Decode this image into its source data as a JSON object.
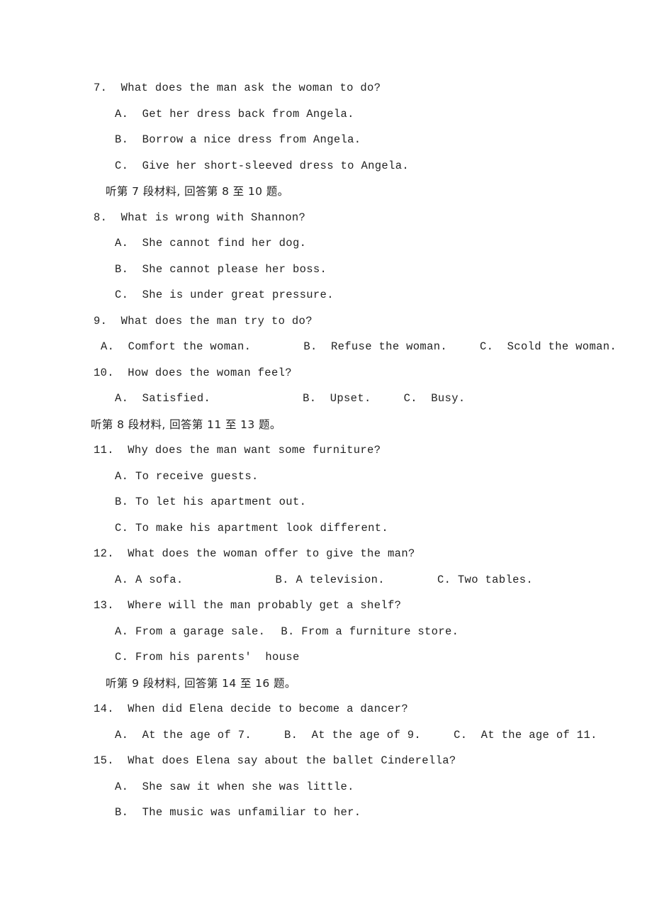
{
  "page": {
    "background_color": "#ffffff",
    "text_color": "#222222"
  },
  "items": [
    {
      "kind": "question",
      "number": "7.",
      "stem": "7.  What does the man ask the woman to do?",
      "options": [
        "A.  Get her dress back from Angela.",
        "B.  Borrow a nice dress from Angela.",
        "C.  Give her short-sleeved dress to Angela."
      ]
    },
    {
      "kind": "section",
      "text": "听第 7 段材料, 回答第 8 至 10 题。",
      "indent": "indented"
    },
    {
      "kind": "question",
      "number": "8.",
      "stem": "8.  What is wrong with Shannon?",
      "options": [
        "A.  She cannot find her dog.",
        "B.  She cannot please her boss.",
        "C.  She is under great pressure."
      ]
    },
    {
      "kind": "question",
      "number": "9.",
      "stem": "9.  What does the man try to do?",
      "inline_options": {
        "a": "A.  Comfort the woman.",
        "b": "B.  Refuse the woman.",
        "c": "C.  Scold the woman."
      }
    },
    {
      "kind": "question",
      "number": "10.",
      "stem": "10.  How does the woman feel?",
      "inline_options": {
        "a": "A.  Satisfied.",
        "b": "B.  Upset.",
        "c": "C.  Busy."
      }
    },
    {
      "kind": "section",
      "text": "听第 8 段材料, 回答第 11 至 13 题。",
      "indent": "flush"
    },
    {
      "kind": "question",
      "number": "11.",
      "stem": "11.  Why does the man want some furniture?",
      "options": [
        "A. To receive guests.",
        "B. To let his apartment out.",
        "C. To make his apartment look different."
      ]
    },
    {
      "kind": "question",
      "number": "12.",
      "stem": "12.  What does the woman offer to give the man?",
      "inline_options": {
        "a": "A. A sofa.",
        "b": "B. A television.",
        "c": "C. Two tables."
      }
    },
    {
      "kind": "question",
      "number": "13.",
      "stem": "13.  Where will the man probably get a shelf?",
      "inline_options": {
        "a": "A. From a garage sale.",
        "b": "B. From a furniture store."
      },
      "options": [
        "C. From his parents'  house"
      ]
    },
    {
      "kind": "section",
      "text": "听第 9 段材料, 回答第 14 至 16 题。",
      "indent": "indented"
    },
    {
      "kind": "question",
      "number": "14.",
      "stem": "14.  When did Elena decide to become a dancer?",
      "inline_options": {
        "a": "A.  At the age of 7.",
        "b": "B.  At the age of 9.",
        "c": "C.  At the age of 11."
      }
    },
    {
      "kind": "question",
      "number": "15.",
      "stem": "15.  What does Elena say about the ballet Cinderella?",
      "options": [
        "A.  She saw it when she was little.",
        "B.  The music was unfamiliar to her."
      ]
    }
  ]
}
